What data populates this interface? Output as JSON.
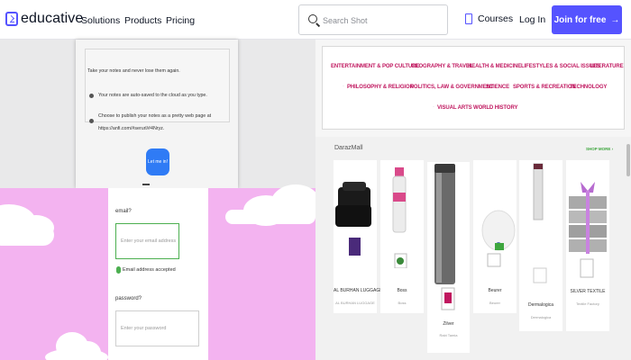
{
  "nav": {
    "logo_text": "educative",
    "links": [
      "Solutions",
      "Products",
      "Pricing"
    ],
    "search_placeholder": "Search Shot",
    "courses": "Courses",
    "login": "Log In",
    "join": "Join for free",
    "join_arrow": "→"
  },
  "modal": {
    "line1": "Take your notes and never lose them again.",
    "line2": "Your notes are auto-saved to the cloud as you type.",
    "line3": "Choose to publish your notes as a pretty web page at",
    "line4": "https://anfi.com/#serurl/#4Nryz.",
    "button": "Let me in!"
  },
  "form": {
    "email_label": "email?",
    "email_placeholder": "Enter your email address",
    "email_ok": "Email address accepted",
    "password_label": "password?",
    "password_placeholder": "Enter your password"
  },
  "categories": {
    "row1": [
      "ENTERTAINMENT & POP CULTURE",
      "GEOGRAPHY & TRAVEL",
      "HEALTH & MEDICINE",
      "LIFESTYLES & SOCIAL ISSUES",
      "LITERATURE"
    ],
    "row2": [
      "PHILOSOPHY & RELIGION",
      "POLITICS, LAW & GOVERNMENT",
      "SCIENCE",
      "SPORTS & RECREATION",
      "TECHNOLOGY"
    ],
    "row3": [
      "VISUAL ARTS",
      "WORLD HISTORY"
    ],
    "color": "#c0175f"
  },
  "mall": {
    "title": "DarazMall",
    "shop_more": "SHOP MORE ›",
    "cards": [
      {
        "name": "AL BURHAN LUGGAGE",
        "sub": "AL BURHAN LUGGAGE"
      },
      {
        "name": "Boss",
        "sub": "Boss"
      },
      {
        "name": "Zilver",
        "sub": "Rabi Tamia"
      },
      {
        "name": "Beurer",
        "sub": "Beurer"
      },
      {
        "name": "Dermalogica",
        "sub": "Dermalogica"
      },
      {
        "name": "SILVER TEXTILE",
        "sub": "Textile Factory"
      }
    ]
  },
  "colors": {
    "brand": "#5553ff",
    "pink_bg": "#f3b3f0",
    "daraz_green": "#3ea63e"
  }
}
